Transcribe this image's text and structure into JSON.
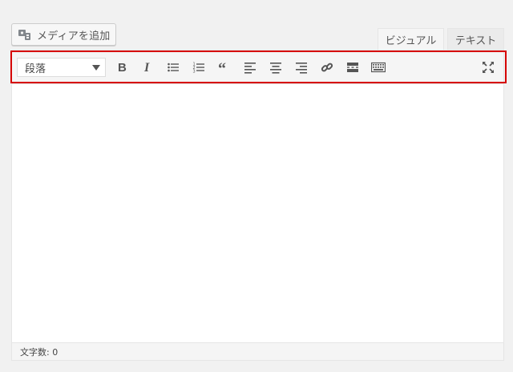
{
  "media": {
    "add_label": "メディアを追加",
    "icon": "media-icon"
  },
  "tabs": {
    "visual": "ビジュアル",
    "text": "テキスト"
  },
  "toolbar": {
    "format": "段落",
    "buttons": [
      {
        "name": "bold",
        "icon": "bold-icon"
      },
      {
        "name": "italic",
        "icon": "italic-icon"
      },
      {
        "name": "bulleted-list",
        "icon": "bullet-list-icon"
      },
      {
        "name": "numbered-list",
        "icon": "numbered-list-icon"
      },
      {
        "name": "blockquote",
        "icon": "blockquote-icon"
      },
      {
        "name": "align-left",
        "icon": "align-left-icon"
      },
      {
        "name": "align-center",
        "icon": "align-center-icon"
      },
      {
        "name": "align-right",
        "icon": "align-right-icon"
      },
      {
        "name": "insert-link",
        "icon": "link-icon"
      },
      {
        "name": "read-more",
        "icon": "read-more-icon"
      },
      {
        "name": "toolbar-toggle",
        "icon": "keyboard-icon"
      },
      {
        "name": "fullscreen",
        "icon": "fullscreen-icon"
      }
    ]
  },
  "status": {
    "word_count": "文字数: 0"
  },
  "colors": {
    "highlight": "#d60000",
    "icon": "#555555"
  }
}
